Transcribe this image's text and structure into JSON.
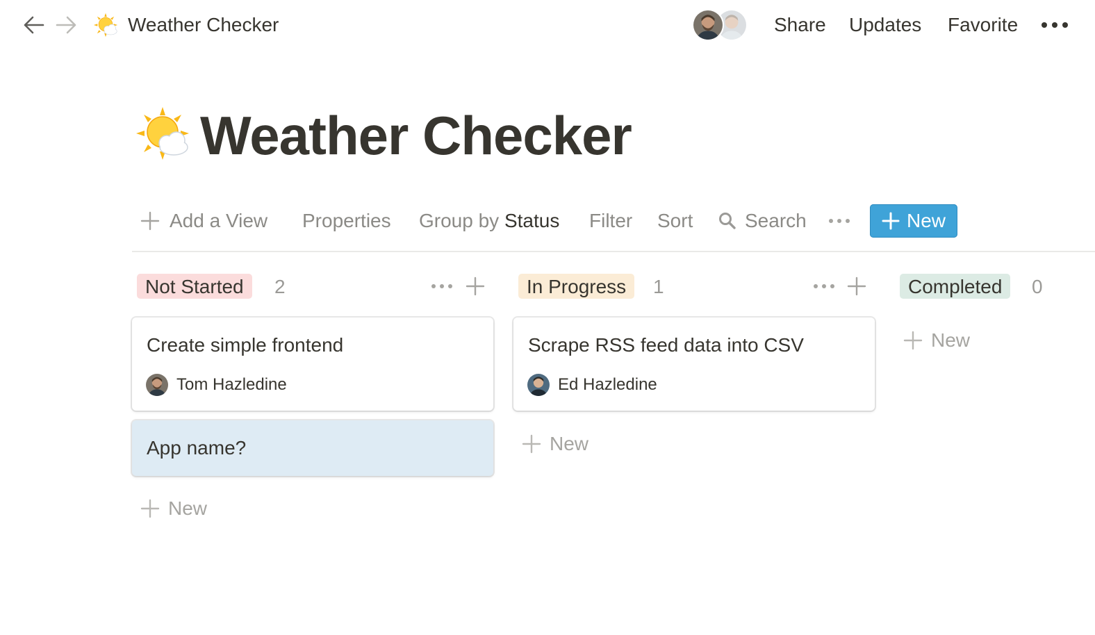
{
  "topbar": {
    "breadcrumb_title": "Weather Checker",
    "actions": {
      "share": "Share",
      "updates": "Updates",
      "favorite": "Favorite"
    }
  },
  "page": {
    "title": "Weather Checker",
    "icon": "sun-behind-cloud-icon"
  },
  "toolbar": {
    "add_view": "Add a View",
    "properties": "Properties",
    "group_by_prefix": "Group by",
    "group_by_value": "Status",
    "filter": "Filter",
    "sort": "Sort",
    "search": "Search",
    "new_button": "New"
  },
  "board": {
    "add_new_label": "New",
    "columns": [
      {
        "status": "Not Started",
        "count": "2",
        "color": "#fbdcdc",
        "cards": [
          {
            "title": "Create simple frontend",
            "assignee": "Tom Hazledine"
          },
          {
            "title": "App name?",
            "highlight": "#deebf4"
          }
        ]
      },
      {
        "status": "In Progress",
        "count": "1",
        "color": "#fbecd6",
        "cards": [
          {
            "title": "Scrape RSS feed data into CSV",
            "assignee": "Ed Hazledine"
          }
        ]
      },
      {
        "status": "Completed",
        "count": "0",
        "color": "#dcebe4",
        "cards": []
      }
    ]
  },
  "colors": {
    "accent": "#3fa3d8",
    "text": "#37352f",
    "muted": "#8b8a86"
  }
}
